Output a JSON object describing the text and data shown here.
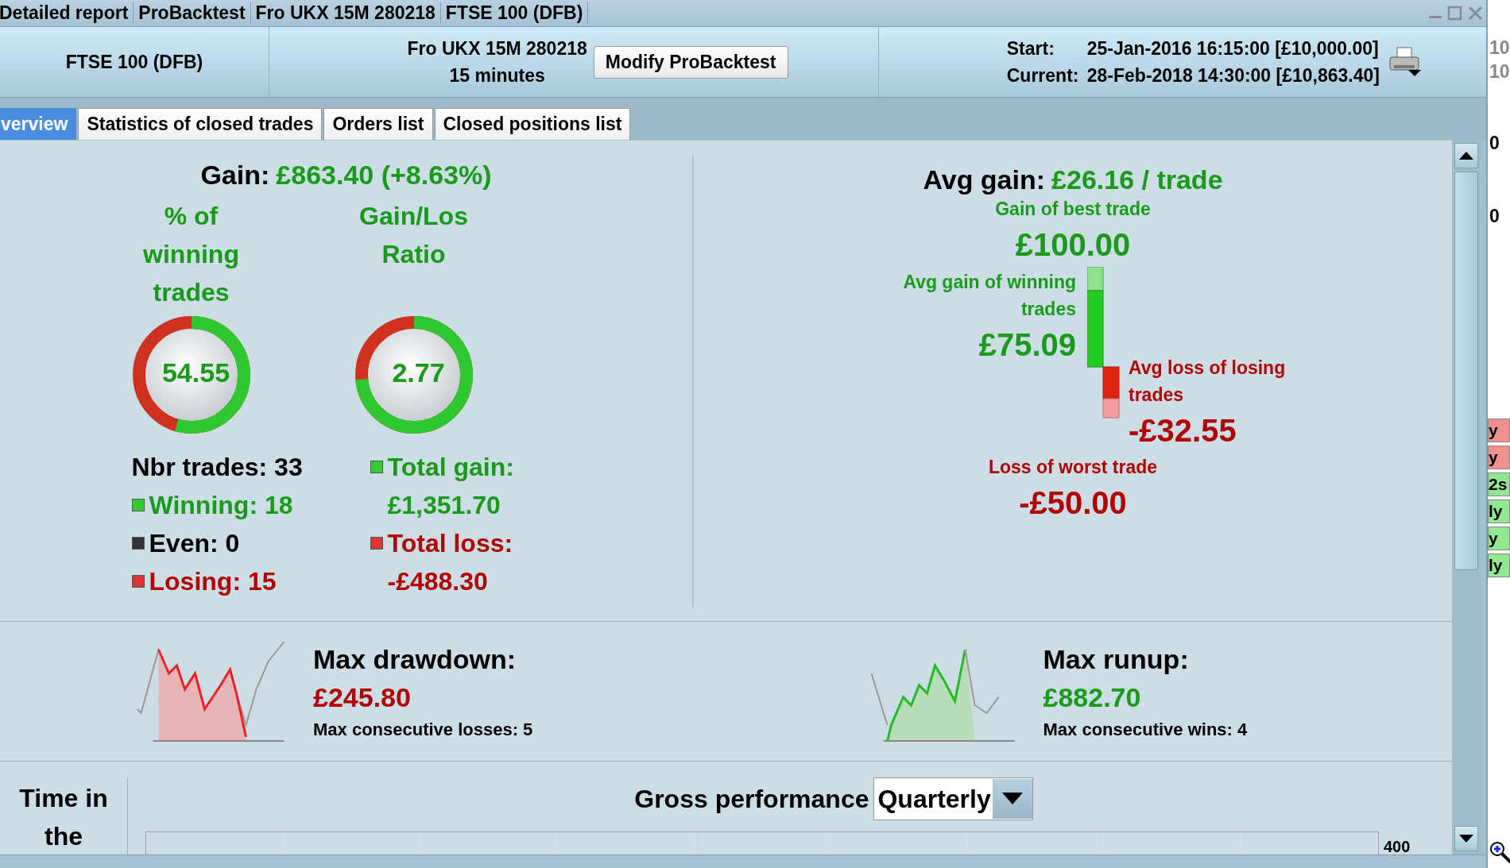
{
  "title_bar": {
    "segments": [
      "Detailed report",
      "ProBacktest",
      "Fro UKX 15M  280218",
      "FTSE 100 (DFB)"
    ]
  },
  "header": {
    "instrument": "FTSE 100 (DFB)",
    "system_name": "Fro UKX 15M  280218",
    "timeframe": "15 minutes",
    "modify_button": "Modify ProBacktest",
    "start_label": "Start:",
    "start_value": "25-Jan-2016 16:15:00 [£10,000.00]",
    "current_label": "Current:",
    "current_value": "28-Feb-2018 14:30:00 [£10,863.40]"
  },
  "tabs": [
    {
      "label": "verview",
      "selected": true
    },
    {
      "label": "Statistics of closed trades",
      "selected": false
    },
    {
      "label": "Orders list",
      "selected": false
    },
    {
      "label": "Closed positions list",
      "selected": false
    }
  ],
  "gain": {
    "label": "Gain:",
    "value": "£863.40 (+8.63%)"
  },
  "gauges": [
    {
      "title": "% of winning trades",
      "value": "54.55"
    },
    {
      "title": "Gain/Los Ratio",
      "value": "2.77"
    }
  ],
  "trade_counts": [
    {
      "label": "Nbr trades: 33",
      "kind": "total"
    },
    {
      "label": "Winning: 18",
      "kind": "win"
    },
    {
      "label": "Even: 0",
      "kind": "even"
    },
    {
      "label": "Losing: 15",
      "kind": "loss"
    }
  ],
  "totals": [
    {
      "label": "Total gain:",
      "value": "£1,351.70",
      "kind": "gain"
    },
    {
      "label": "Total loss:",
      "value": "-£488.30",
      "kind": "loss"
    }
  ],
  "avg_gain": {
    "label": "Avg gain:",
    "value": "£26.16 / trade"
  },
  "best_trade": {
    "label": "Gain of best trade",
    "value": "£100.00"
  },
  "avg_win": {
    "label": "Avg gain of winning trades",
    "value": "£75.09"
  },
  "avg_loss": {
    "label": "Avg loss of losing trades",
    "value": "-£32.55"
  },
  "worst_trade": {
    "label": "Loss of worst trade",
    "value": "-£50.00"
  },
  "drawdown": {
    "label": "Max drawdown:",
    "value": "£245.80",
    "note": "Max consecutive losses: 5"
  },
  "runup": {
    "label": "Max runup:",
    "value": "£882.70",
    "note": "Max consecutive wins: 4"
  },
  "time_in": "Time in the",
  "gross": {
    "label": "Gross performance",
    "period": "Quarterly",
    "tick": "400"
  },
  "side_strip": {
    "numbers": [
      "10",
      "10",
      "0",
      "0"
    ],
    "tags": [
      {
        "text": "y",
        "color": "#f09090"
      },
      {
        "text": "y",
        "color": "#f09090"
      },
      {
        "text": "2s",
        "color": "#90e890"
      },
      {
        "text": "ly",
        "color": "#90e890"
      },
      {
        "text": "y",
        "color": "#90e890"
      },
      {
        "text": "ly",
        "color": "#90e890"
      }
    ]
  }
}
